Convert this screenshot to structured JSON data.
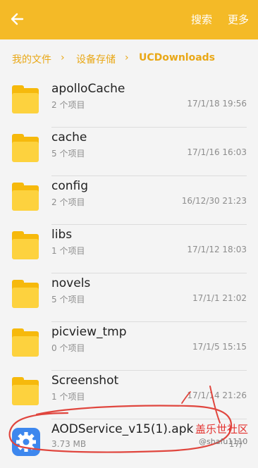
{
  "header": {
    "search_label": "搜索",
    "more_label": "更多",
    "accent": "#f4ba27"
  },
  "breadcrumb": {
    "items": [
      "我的文件",
      "设备存储",
      "UCDownloads"
    ]
  },
  "files": [
    {
      "name": "apolloCache",
      "meta": "2 个项目",
      "time": "17/1/18 19:56",
      "icon": "folder-icon"
    },
    {
      "name": "cache",
      "meta": "5 个项目",
      "time": "17/1/16 16:03",
      "icon": "folder-icon"
    },
    {
      "name": "config",
      "meta": "2 个项目",
      "time": "16/12/30 21:23",
      "icon": "folder-icon"
    },
    {
      "name": "libs",
      "meta": "1 个项目",
      "time": "17/1/12 18:03",
      "icon": "folder-icon"
    },
    {
      "name": "novels",
      "meta": "5 个项目",
      "time": "17/1/1 21:02",
      "icon": "folder-icon"
    },
    {
      "name": "picview_tmp",
      "meta": "0 个项目",
      "time": "17/1/5 15:15",
      "icon": "folder-icon"
    },
    {
      "name": "Screenshot",
      "meta": "1 个项目",
      "time": "17/1/14 21:26",
      "icon": "folder-icon"
    },
    {
      "name": "AODService_v15(1).apk",
      "meta": "3.73 MB",
      "time": "17/",
      "icon": "settings-gear-icon"
    }
  ],
  "watermark": {
    "text": "盖乐世社区",
    "user": "@shafu1110"
  }
}
